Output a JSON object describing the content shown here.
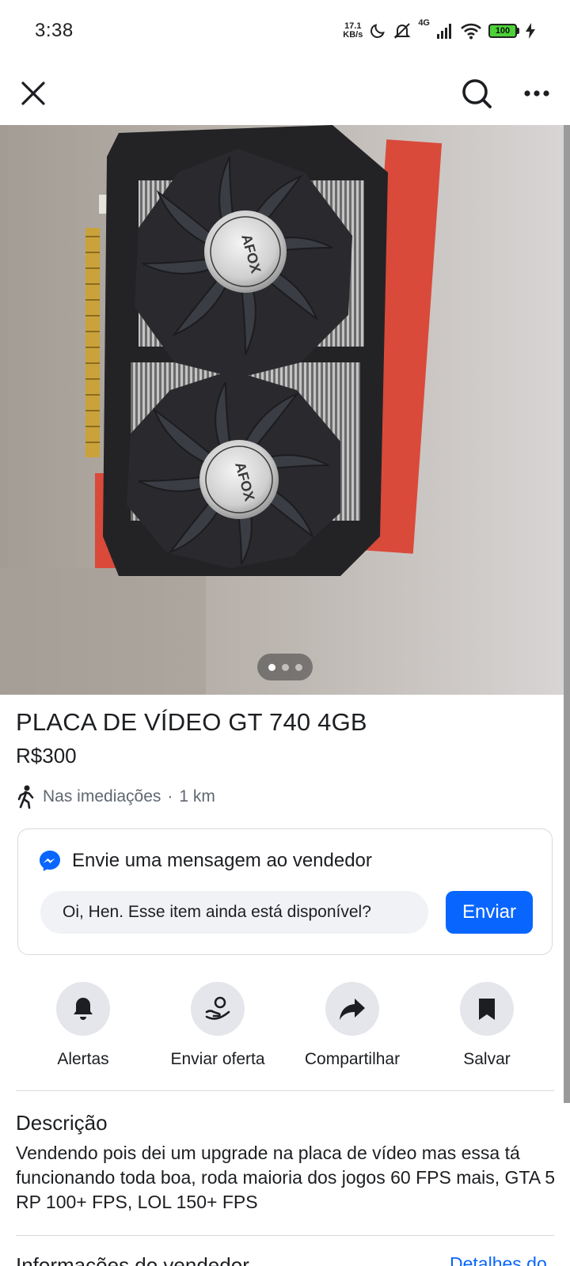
{
  "status_bar": {
    "time": "3:38",
    "net_speed_value": "17.1",
    "net_speed_unit": "KB/s",
    "network": "4G",
    "battery": "100",
    "icons": [
      "moon-icon",
      "mute-icon",
      "signal-icon",
      "wifi-icon",
      "battery-icon",
      "charging-icon"
    ]
  },
  "top_bar": {
    "icons": [
      "close-icon",
      "search-icon",
      "more-icon"
    ]
  },
  "gallery": {
    "image_count": 3,
    "active_index": 0,
    "logo_text": "AFOX"
  },
  "listing": {
    "title": "PLACA DE VÍDEO GT 740 4GB",
    "price": "R$300",
    "location": "Nas imediações",
    "separator": "·",
    "distance": "1 km"
  },
  "message": {
    "heading": "Envie uma mensagem ao vendedor",
    "input_value": "Oi, Hen. Esse item ainda está disponível?",
    "send_label": "Enviar"
  },
  "actions": [
    {
      "label": "Alertas",
      "icon": "bell-icon"
    },
    {
      "label": "Enviar oferta",
      "icon": "offer-icon"
    },
    {
      "label": "Compartilhar",
      "icon": "share-icon"
    },
    {
      "label": "Salvar",
      "icon": "bookmark-icon"
    }
  ],
  "description": {
    "title": "Descrição",
    "text": "Vendendo pois dei um upgrade na placa de vídeo mas essa tá funcionando toda boa, roda maioria dos jogos 60 FPS mais, GTA 5 RP 100+ FPS, LOL 150+ FPS"
  },
  "seller": {
    "title": "Informações do vendedor",
    "link": "Detalhes do"
  },
  "colors": {
    "accent": "#0866ff",
    "pill_bg": "#f0f2f5",
    "action_bg": "#e4e6eb",
    "secondary_text": "#606770"
  }
}
